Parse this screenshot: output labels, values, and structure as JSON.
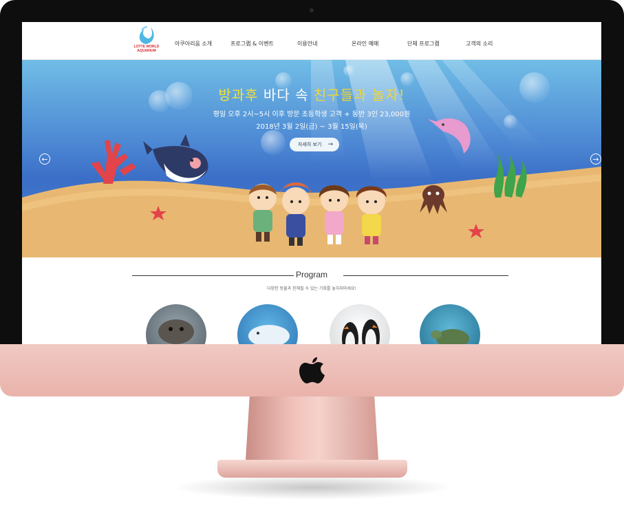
{
  "nav": {
    "logo_text": "LOTTE WORLD AQUARIUM",
    "items": [
      "아쿠아리움 소개",
      "프로그램 & 이벤트",
      "이용안내",
      "온라인 예매",
      "단체 프로그램",
      "고객의 소리"
    ]
  },
  "hero": {
    "title_part1": "방과후",
    "title_part2": "바다 속",
    "title_part3": "친구들과 놀자!",
    "subtitle": "평일 오후 2시~5시 이후 방문 초등학생 고객 + 동반 3인 23,000원",
    "date": "2018년 3월 2일(금) ~ 3월 15일(목)",
    "button_label": "자세히 보기",
    "prev_arrow": "←",
    "next_arrow": "→"
  },
  "program": {
    "title": "Program",
    "subtitle": "다양한 동물과 친해질 수 있는 기회를 놓치지마세요!",
    "items": [
      "seal",
      "beluga",
      "penguin",
      "sea-turtle"
    ]
  },
  "colors": {
    "chin": "#e9b3ab",
    "bezel": "#0e0e0e",
    "title_yellow": "#f6e233",
    "sand": "#e8b872"
  }
}
